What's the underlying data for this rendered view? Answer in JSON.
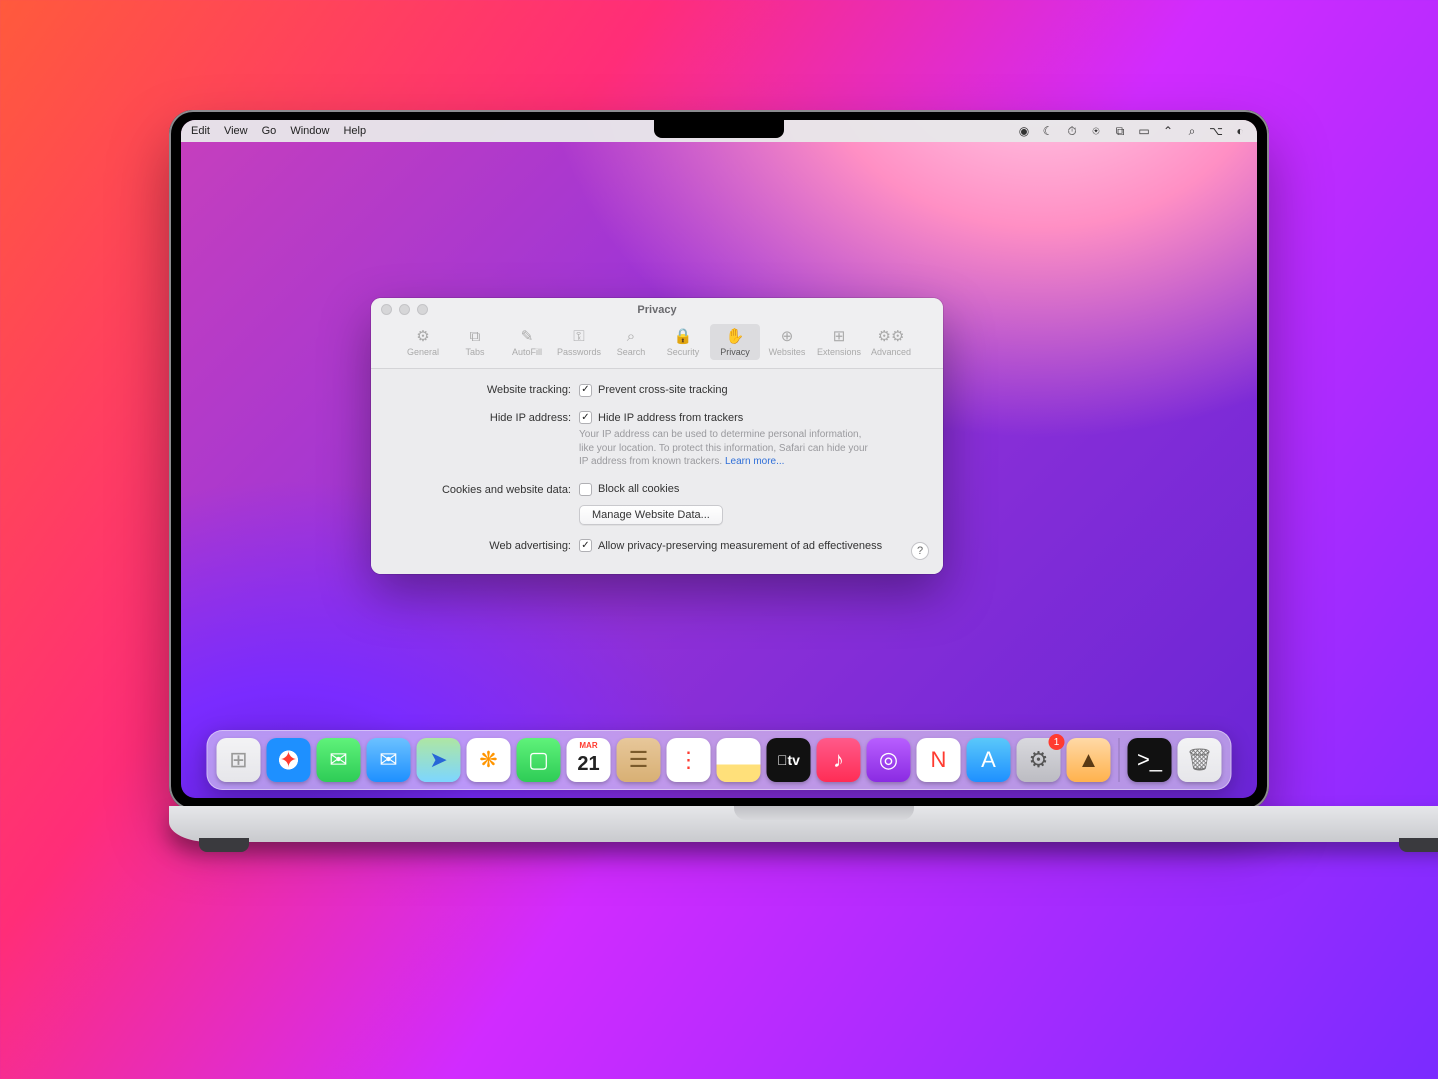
{
  "menubar": {
    "items": [
      "Edit",
      "View",
      "Go",
      "Window",
      "Help"
    ]
  },
  "statusIcons": [
    "record",
    "moon",
    "clock",
    "user",
    "copy",
    "battery",
    "wifi",
    "search",
    "control",
    "siri",
    "time"
  ],
  "prefs": {
    "title": "Privacy",
    "tabs": [
      {
        "id": "general",
        "label": "General",
        "icon": "gear"
      },
      {
        "id": "tabs",
        "label": "Tabs",
        "icon": "tabs"
      },
      {
        "id": "autofill",
        "label": "AutoFill",
        "icon": "pencil"
      },
      {
        "id": "passwords",
        "label": "Passwords",
        "icon": "key"
      },
      {
        "id": "search",
        "label": "Search",
        "icon": "magnify"
      },
      {
        "id": "security",
        "label": "Security",
        "icon": "lock"
      },
      {
        "id": "privacy",
        "label": "Privacy",
        "icon": "hand",
        "active": true
      },
      {
        "id": "websites",
        "label": "Websites",
        "icon": "globe"
      },
      {
        "id": "extensions",
        "label": "Extensions",
        "icon": "puzzle"
      },
      {
        "id": "advanced",
        "label": "Advanced",
        "icon": "gears"
      }
    ],
    "rows": {
      "tracking": {
        "label": "Website tracking:",
        "checkbox": "Prevent cross-site tracking",
        "checked": true
      },
      "hideip": {
        "label": "Hide IP address:",
        "checkbox": "Hide IP address from trackers",
        "checked": true,
        "help": "Your IP address can be used to determine personal information, like your location. To protect this information, Safari can hide your IP address from known trackers. ",
        "helplink": "Learn more..."
      },
      "cookies": {
        "label": "Cookies and website data:",
        "checkbox": "Block all cookies",
        "checked": false,
        "button": "Manage Website Data..."
      },
      "ads": {
        "label": "Web advertising:",
        "checkbox": "Allow privacy-preserving measurement of ad effectiveness",
        "checked": true
      }
    },
    "helpGlyph": "?"
  },
  "dock": {
    "items": [
      {
        "name": "launchpad",
        "bg": "linear-gradient(#f3f3f5,#e6e6ea)",
        "glyph": "⊞",
        "color": "#999"
      },
      {
        "name": "safari",
        "bg": "radial-gradient(circle,#fff 30%,#1e90ff 31%)",
        "glyph": "✦",
        "color": "#ff3b30"
      },
      {
        "name": "messages",
        "bg": "linear-gradient(#5ff27a,#2ecc56)",
        "glyph": "✉",
        "color": "#fff"
      },
      {
        "name": "mail",
        "bg": "linear-gradient(#6bc1ff,#1e90ff)",
        "glyph": "✉",
        "color": "#fff"
      },
      {
        "name": "maps",
        "bg": "linear-gradient(#aee6a3,#7dd6ff)",
        "glyph": "➤",
        "color": "#2766d8"
      },
      {
        "name": "photos",
        "bg": "#fff",
        "glyph": "❋",
        "color": "#ff9500"
      },
      {
        "name": "facetime",
        "bg": "linear-gradient(#5ff27a,#2ecc56)",
        "glyph": "▢",
        "color": "#fff"
      },
      {
        "name": "calendar",
        "bg": "#fff",
        "glyph": "21",
        "color": "#222",
        "toplabel": "MAR"
      },
      {
        "name": "contacts",
        "bg": "linear-gradient(#e7c79a,#d8b074)",
        "glyph": "☰",
        "color": "#7a5a2b"
      },
      {
        "name": "reminders",
        "bg": "#fff",
        "glyph": "⋮",
        "color": "#ff3b30"
      },
      {
        "name": "notes",
        "bg": "linear-gradient(#fff 60%,#ffe07a 60%)",
        "glyph": "",
        "color": "#333"
      },
      {
        "name": "tv",
        "bg": "#111",
        "glyph": "tv",
        "color": "#fff"
      },
      {
        "name": "music",
        "bg": "linear-gradient(#ff5a8a,#ff2d55)",
        "glyph": "♪",
        "color": "#fff"
      },
      {
        "name": "podcasts",
        "bg": "linear-gradient(#b85eff,#8a2be2)",
        "glyph": "◎",
        "color": "#fff"
      },
      {
        "name": "news",
        "bg": "#fff",
        "glyph": "N",
        "color": "#ff3b30"
      },
      {
        "name": "appstore",
        "bg": "linear-gradient(#5ac8fa,#1e90ff)",
        "glyph": "A",
        "color": "#fff"
      },
      {
        "name": "settings",
        "bg": "linear-gradient(#d9d9de,#bcbcc2)",
        "glyph": "⚙",
        "color": "#555",
        "badge": "1"
      },
      {
        "name": "cleanmymac",
        "bg": "linear-gradient(#ffd9a6,#ffb24d)",
        "glyph": "▲",
        "color": "#5a3a14"
      }
    ],
    "after": [
      {
        "name": "terminal",
        "bg": "#111",
        "glyph": ">_",
        "color": "#fff"
      },
      {
        "name": "trash",
        "bg": "linear-gradient(#f3f3f5,#e6e6ea)",
        "glyph": "🗑",
        "color": "#777"
      }
    ]
  }
}
